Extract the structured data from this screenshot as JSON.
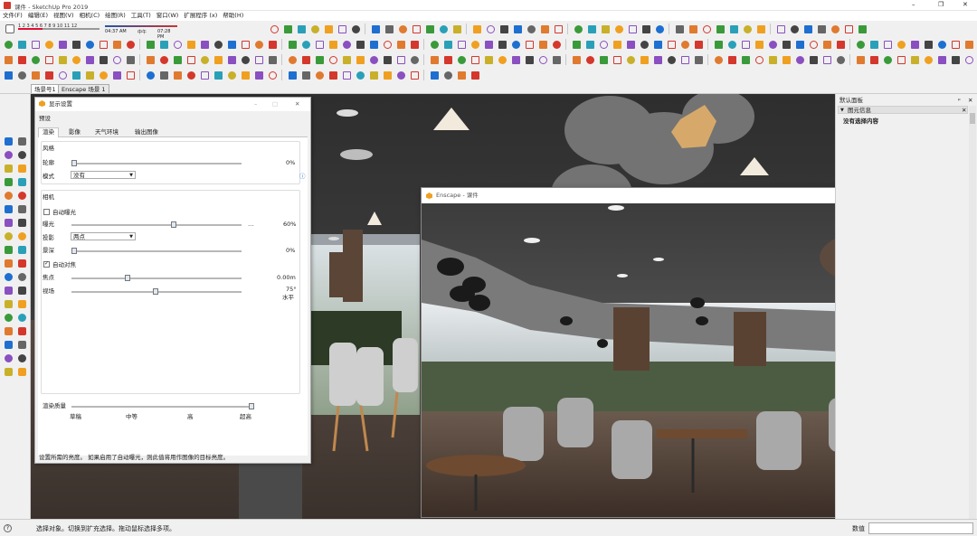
{
  "window": {
    "title": "课件 - SketchUp Pro 2019",
    "controls": [
      "–",
      "❐",
      "✕"
    ]
  },
  "menu": [
    "文件(F)",
    "编辑(E)",
    "视图(V)",
    "相机(C)",
    "绘图(R)",
    "工具(T)",
    "窗口(W)",
    "扩展程序 (x)",
    "帮助(H)"
  ],
  "shadow": {
    "months": "1 2 3 4 5 6 7 8 9 10 11 12",
    "time_start": "04:37 AM",
    "noon": "中午",
    "time_end": "07:28 PM"
  },
  "scenes": [
    "场景号1",
    "Enscape 场景 1"
  ],
  "display_dialog": {
    "title": "显示设置",
    "preset_label": "预设",
    "tabs": [
      "渲染",
      "影像",
      "天气环境",
      "输出图像"
    ],
    "style_section": "风格",
    "outline_label": "轮廓",
    "outline_value": "0%",
    "mode_label": "模式",
    "mode_value": "没有",
    "camera_section": "相机",
    "auto_exposure_label": "自动曝光",
    "exposure_label": "曝光",
    "exposure_value": "60%",
    "projection_label": "投影",
    "projection_value": "两点",
    "dof_label": "景深",
    "dof_value": "0%",
    "auto_focus_label": "自动对焦",
    "focus_label": "焦点",
    "focus_value": "0.00m",
    "fov_label": "视场",
    "fov_value": "75°",
    "fov_unit": "水平",
    "quality_label": "渲染质量",
    "quality_levels": [
      "草稿",
      "中等",
      "高",
      "超高"
    ],
    "footer": "设置所需的亮度。 如果启用了自动曝光，则此值将用作图像的目标亮度。"
  },
  "enscape": {
    "title": "Enscape - 课件"
  },
  "right_panel": {
    "title": "默认面板",
    "section": "图元信息",
    "content": "没有选择内容"
  },
  "status": {
    "message": "选择对象。切换到扩充选择。拖动鼠标选择多项。",
    "measurements_label": "数值"
  },
  "colors": {
    "accent": "#1e6fd0",
    "sketchup_red": "#d4372c",
    "enscape_orange": "#f0a020"
  }
}
